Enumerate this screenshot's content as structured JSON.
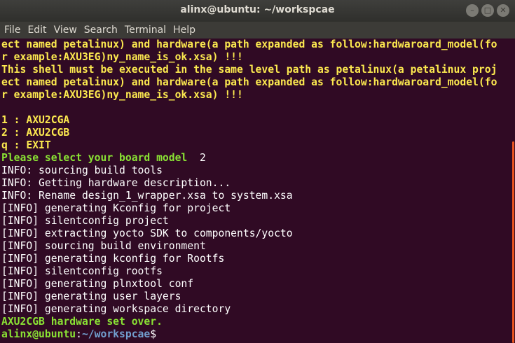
{
  "window": {
    "title": "alinx@ubuntu: ~/workspcae"
  },
  "controls": {
    "minimize": "–",
    "maximize": "□",
    "close": "✕"
  },
  "menu": [
    "File",
    "Edit",
    "View",
    "Search",
    "Terminal",
    "Help"
  ],
  "lines": [
    {
      "text": "ect named petalinux) and hardware(a path expanded as follow:hardwaroard_model(fo",
      "style": "yellow"
    },
    {
      "text": "r example:AXU3EG)ny_name_is_ok.xsa) !!!",
      "style": "yellow"
    },
    {
      "text": "This shell must be executed in the same level path as petalinux(a petalinux proj",
      "style": "yellow"
    },
    {
      "text": "ect named petalinux) and hardware(a path expanded as follow:hardwaroard_model(fo",
      "style": "yellow"
    },
    {
      "text": "r example:AXU3EG)ny_name_is_ok.xsa) !!!",
      "style": "yellow"
    },
    {
      "text": "",
      "style": ""
    },
    {
      "text": "1 : AXU2CGA",
      "style": "yellow"
    },
    {
      "text": "2 : AXU2CGB",
      "style": "yellow"
    },
    {
      "text": "q : EXIT",
      "style": "yellow"
    },
    {
      "text": "Please select your board model",
      "style": "green",
      "input": "  2"
    },
    {
      "text": "INFO: sourcing build tools",
      "style": ""
    },
    {
      "text": "INFO: Getting hardware description...",
      "style": ""
    },
    {
      "text": "INFO: Rename design_1_wrapper.xsa to system.xsa",
      "style": ""
    },
    {
      "text": "[INFO] generating Kconfig for project",
      "style": ""
    },
    {
      "text": "[INFO] silentconfig project",
      "style": ""
    },
    {
      "text": "[INFO] extracting yocto SDK to components/yocto",
      "style": ""
    },
    {
      "text": "[INFO] sourcing build environment",
      "style": ""
    },
    {
      "text": "[INFO] generating kconfig for Rootfs",
      "style": ""
    },
    {
      "text": "[INFO] silentconfig rootfs",
      "style": ""
    },
    {
      "text": "[INFO] generating plnxtool conf",
      "style": ""
    },
    {
      "text": "[INFO] generating user layers",
      "style": ""
    },
    {
      "text": "[INFO] generating workspace directory",
      "style": ""
    },
    {
      "text": "AXU2CGB hardware set over.",
      "style": "green"
    }
  ],
  "prompt": {
    "user_host": "alinx@ubuntu",
    "separator": ":",
    "path": "~/workspcae",
    "symbol": "$"
  },
  "colors": {
    "background": "#300a24",
    "accent": "#e95420",
    "yellow": "#fce94f",
    "green": "#8ae234",
    "blue": "#729fcf"
  }
}
